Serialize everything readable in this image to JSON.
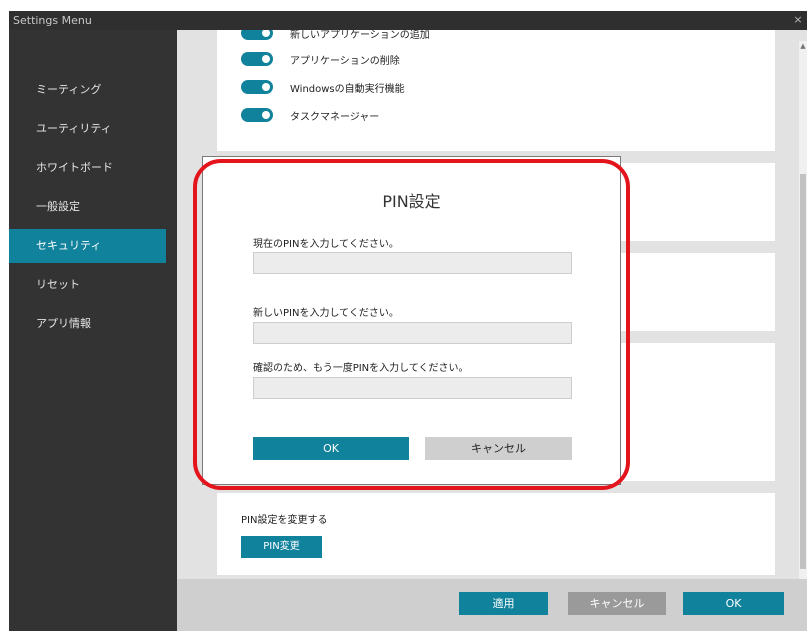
{
  "window": {
    "title": "Settings Menu",
    "close_symbol": "×"
  },
  "sidebar": {
    "items": [
      {
        "label": "ミーティング",
        "active": false
      },
      {
        "label": "ユーティリティ",
        "active": false
      },
      {
        "label": "ホワイトボード",
        "active": false
      },
      {
        "label": "一般設定",
        "active": false
      },
      {
        "label": "セキュリティ",
        "active": true
      },
      {
        "label": "リセット",
        "active": false
      },
      {
        "label": "アプリ情報",
        "active": false
      }
    ]
  },
  "security": {
    "toggles": [
      {
        "label": "新しいアプリケーションの追加",
        "on": true
      },
      {
        "label": "アプリケーションの削除",
        "on": true
      },
      {
        "label": "Windowsの自動実行機能",
        "on": true
      },
      {
        "label": "タスクマネージャー",
        "on": true
      }
    ],
    "pin_section": {
      "label": "PIN設定を変更する",
      "button": "PIN変更"
    }
  },
  "dialog": {
    "title": "PIN設定",
    "current_pin_label": "現在のPINを入力してください。",
    "new_pin_label": "新しいPINを入力してください。",
    "confirm_pin_label": "確認のため、もう一度PINを入力してください。",
    "current_pin_value": "",
    "new_pin_value": "",
    "confirm_pin_value": "",
    "ok": "OK",
    "cancel": "キャンセル"
  },
  "footer": {
    "apply": "適用",
    "cancel": "キャンセル",
    "ok": "OK"
  },
  "colors": {
    "accent": "#10829c",
    "sidebar_bg": "#333333",
    "titlebar_bg": "#2f2f2f",
    "highlight": "#e3141b",
    "gray_button": "#9a9a9a"
  }
}
